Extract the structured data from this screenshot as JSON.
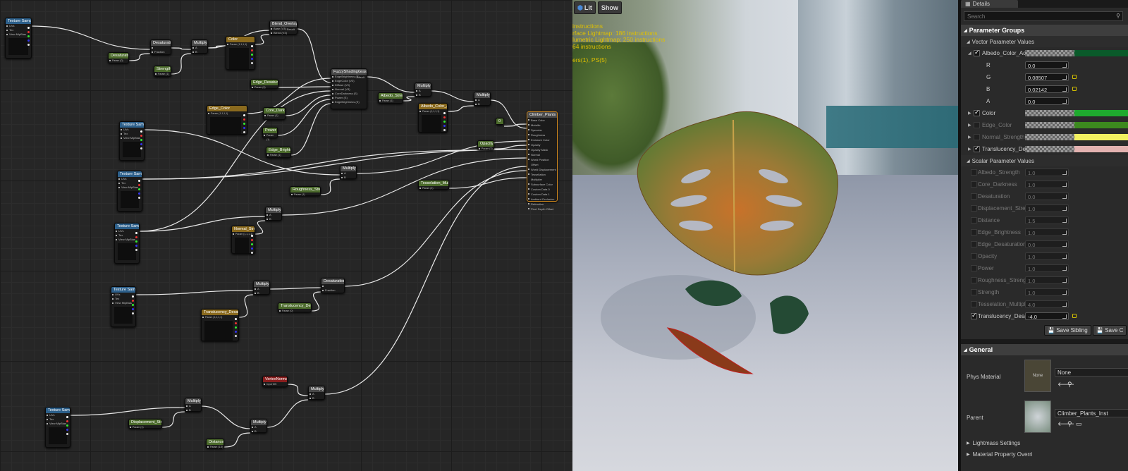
{
  "graph": {
    "nodes": [
      {
        "id": "ts1",
        "type": "texture",
        "title": "Texture Sample",
        "pins": [
          "UVs",
          "Tex",
          "View MipBias"
        ]
      },
      {
        "id": "desat_param",
        "type": "param",
        "title": "Desaturation",
        "sub": "Param (0)"
      },
      {
        "id": "desat1",
        "type": "op",
        "title": "Desaturation",
        "pins": [
          "",
          "Fraction"
        ]
      },
      {
        "id": "strength",
        "type": "param",
        "title": "Strength",
        "sub": "Param (1)"
      },
      {
        "id": "mult1",
        "type": "op",
        "title": "Multiply",
        "pins": [
          "A",
          "B"
        ]
      },
      {
        "id": "color",
        "type": "vparam",
        "title": "Color",
        "sub": "Param (1,1,1,1)"
      },
      {
        "id": "blend",
        "type": "op",
        "title": "Blend_Overlay",
        "pins": [
          "Base (V3)",
          "Blend (V3)"
        ],
        "out": "Result"
      },
      {
        "id": "fuzzy",
        "type": "op",
        "title": "FuzzyShadingGrass",
        "pins": [
          "EdgeBrightness (S)",
          "EdgeColor (V3)",
          "Diffuse (V3)",
          "Normal (V3)",
          "CoreDarkness (S)",
          "Power (S)",
          "EdgeBrightness (S)"
        ],
        "out": "Result"
      },
      {
        "id": "edge_desat",
        "type": "param",
        "title": "Edge_Desaturation",
        "sub": "Param (0)"
      },
      {
        "id": "edge_color",
        "type": "vparam",
        "title": "Edge_Color",
        "sub": "Param (1,1,1,1)"
      },
      {
        "id": "core_dark",
        "type": "param",
        "title": "Core_Darkness",
        "sub": "Param (1)"
      },
      {
        "id": "power",
        "type": "param",
        "title": "Power",
        "sub": "Param (1)"
      },
      {
        "id": "edge_bright",
        "type": "param",
        "title": "Edge_Brightness",
        "sub": "Param (1)"
      },
      {
        "id": "albedo_str",
        "type": "param",
        "title": "Albedo_Strength",
        "sub": "Param (1)"
      },
      {
        "id": "mult2",
        "type": "op",
        "title": "Multiply",
        "pins": [
          "A",
          "B"
        ]
      },
      {
        "id": "albedo_adj",
        "type": "vparam",
        "title": "Albedo_Color_Adjust",
        "sub": "Param (1,1,1,1)"
      },
      {
        "id": "mult3",
        "type": "op",
        "title": "Multiply",
        "pins": [
          "A",
          "B"
        ]
      },
      {
        "id": "ts2",
        "type": "texture",
        "title": "Texture Sample",
        "pins": [
          "UVs",
          "Tex",
          "View MipBias"
        ]
      },
      {
        "id": "opacity",
        "type": "param",
        "title": "Opacity",
        "sub": "Param (1)"
      },
      {
        "id": "ts3",
        "type": "texture",
        "title": "Texture Sample",
        "pins": [
          "UVs",
          "Tex",
          "View MipBias"
        ]
      },
      {
        "id": "mult4",
        "type": "op",
        "title": "Multiply",
        "pins": [
          "A",
          "B"
        ]
      },
      {
        "id": "rough_str",
        "type": "param",
        "title": "Roughness_Strength",
        "sub": "Param (1)"
      },
      {
        "id": "tess_mult",
        "type": "param",
        "title": "Tesselation_Multiplier",
        "sub": "Param (4)"
      },
      {
        "id": "ts4",
        "type": "texture",
        "title": "Texture Sample",
        "pins": [
          "UVs",
          "Tex",
          "View MipBias"
        ]
      },
      {
        "id": "mult5",
        "type": "op",
        "title": "Multiply",
        "pins": [
          "A",
          "B"
        ]
      },
      {
        "id": "normal_str",
        "type": "vparam",
        "title": "Normal_Strength",
        "sub": "Param (1,1,1,1)"
      },
      {
        "id": "ts5",
        "type": "texture",
        "title": "Texture Sample",
        "pins": [
          "UVs",
          "Tex",
          "View MipBias"
        ]
      },
      {
        "id": "mult6",
        "type": "op",
        "title": "Multiply",
        "pins": [
          "A",
          "B"
        ]
      },
      {
        "id": "desat2",
        "type": "op",
        "title": "Desaturation",
        "pins": [
          "",
          "Fraction"
        ]
      },
      {
        "id": "transl_desat",
        "type": "vparam",
        "title": "Translucency_Desaturation",
        "sub": "Param (1,1,1,1)"
      },
      {
        "id": "transl_desat_p",
        "type": "param",
        "title": "Translucency_Desaturation",
        "sub": "Param (0)"
      },
      {
        "id": "vnormal",
        "type": "red",
        "title": "VertexNormalWS",
        "sub": "Input WS"
      },
      {
        "id": "mult7",
        "type": "op",
        "title": "Multiply",
        "pins": [
          "A",
          "B"
        ]
      },
      {
        "id": "ts6",
        "type": "texture",
        "title": "Texture Sample",
        "pins": [
          "UVs",
          "Tex",
          "View MipBias"
        ]
      },
      {
        "id": "mult8",
        "type": "op",
        "title": "Multiply",
        "pins": [
          "A",
          "B"
        ]
      },
      {
        "id": "disp_str",
        "type": "param",
        "title": "Displacement_Strength",
        "sub": "Param (1)"
      },
      {
        "id": "mult9",
        "type": "op",
        "title": "Multiply",
        "pins": [
          "A",
          "B"
        ]
      },
      {
        "id": "distance",
        "type": "param",
        "title": "Distance",
        "sub": "Param (1.5)"
      },
      {
        "id": "const0",
        "type": "param",
        "title": "0",
        "sub": ""
      },
      {
        "id": "output",
        "type": "output",
        "title": "Climber_Plants",
        "pins": [
          "Base Color",
          "Metallic",
          "Specular",
          "Roughness",
          "Emissive Color",
          "Opacity",
          "Opacity Mask",
          "Normal",
          "World Position Offset",
          "World Displacement",
          "Tessellation Multiplier",
          "Subsurface Color",
          "Custom Data 0",
          "Custom Data 1",
          "Ambient Occlusion",
          "Refraction",
          "Pixel Depth Offset"
        ]
      }
    ]
  },
  "viewport": {
    "lit_label": "Lit",
    "show_label": "Show",
    "stats": [
      "instructions",
      "rface Lightmap: 186 instructions",
      "lumetric Lightmap: 250 instructions",
      "64 instructions",
      "",
      "ers(1), PS(5)"
    ]
  },
  "details": {
    "tab_title": "Details",
    "search_placeholder": "Search",
    "parameter_groups_label": "Parameter Groups",
    "vector_label": "Vector Parameter Values",
    "albedo": {
      "label": "Albedo_Color_Adjus",
      "color": "#0a5a2a",
      "channels": [
        {
          "name": "R",
          "value": "0.0"
        },
        {
          "name": "G",
          "value": "0.08507"
        },
        {
          "name": "B",
          "value": "0.02142"
        },
        {
          "name": "A",
          "value": "0.0"
        }
      ]
    },
    "vectors": [
      {
        "label": "Color",
        "checked": true,
        "color": "#1eaa2e"
      },
      {
        "label": "Edge_Color",
        "checked": false,
        "color": "#3c8a1e"
      },
      {
        "label": "Normal_Strength",
        "checked": false,
        "color": "#f2f060"
      },
      {
        "label": "Translucency_Desa",
        "checked": true,
        "color": "#e3b2b0"
      }
    ],
    "scalar_label": "Scalar Parameter Values",
    "scalars": [
      {
        "label": "Albedo_Strength",
        "value": "1.0",
        "checked": false
      },
      {
        "label": "Core_Darkness",
        "value": "1.0",
        "checked": false
      },
      {
        "label": "Desaturation",
        "value": "0.0",
        "checked": false
      },
      {
        "label": "Displacement_Stren",
        "value": "1.0",
        "checked": false
      },
      {
        "label": "Distance",
        "value": "1.5",
        "checked": false
      },
      {
        "label": "Edge_Brightness",
        "value": "1.0",
        "checked": false
      },
      {
        "label": "Edge_Desaturation",
        "value": "0.0",
        "checked": false
      },
      {
        "label": "Opacity",
        "value": "1.0",
        "checked": false
      },
      {
        "label": "Power",
        "value": "1.0",
        "checked": false
      },
      {
        "label": "Roughness_Strengh",
        "value": "1.0",
        "checked": false
      },
      {
        "label": "Strength",
        "value": "1.0",
        "checked": false
      },
      {
        "label": "Tesselation_Multipl",
        "value": "4.0",
        "checked": false
      },
      {
        "label": "Translucency_Desat",
        "value": "-4.0",
        "checked": true
      }
    ],
    "save_sibling": "Save Sibling",
    "save_child": "Save C",
    "general_label": "General",
    "phys_material_label": "Phys Material",
    "phys_thumb": "None",
    "phys_value": "None",
    "parent_label": "Parent",
    "parent_value": "Climber_Plants_Inst",
    "lightmass": "Lightmass Settings",
    "mat_prop": "Material Property Overri"
  }
}
